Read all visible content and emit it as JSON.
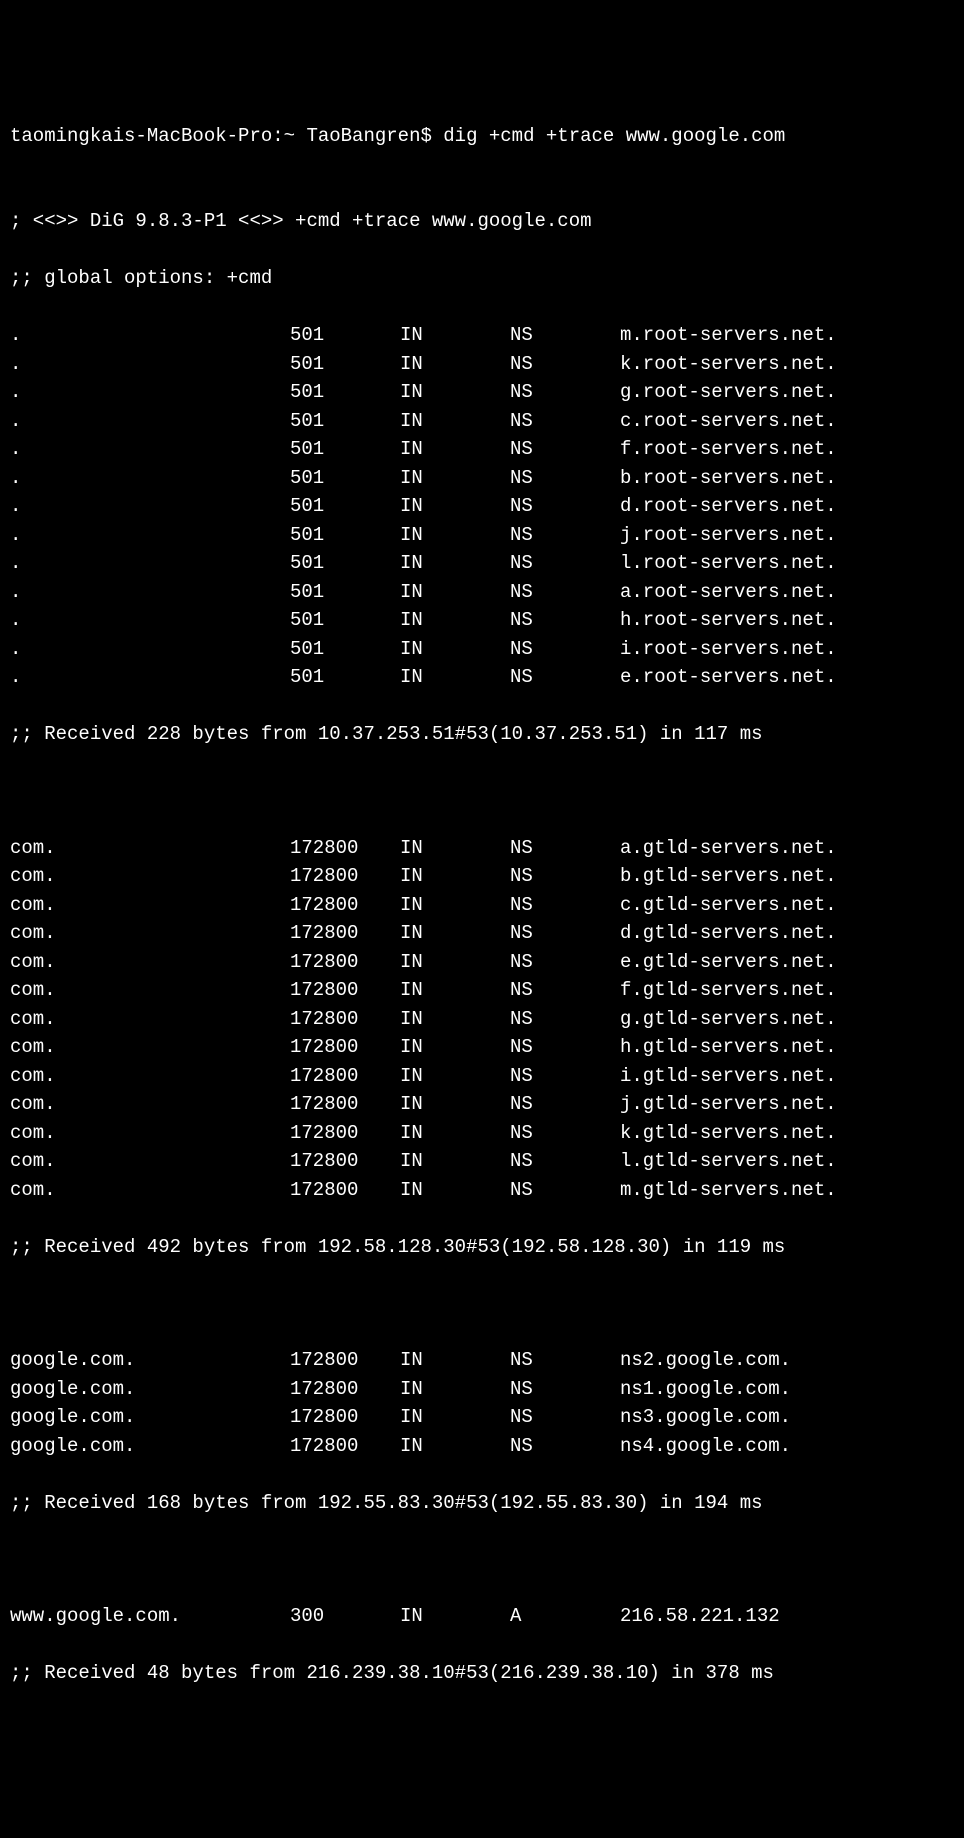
{
  "prompt": "taomingkais-MacBook-Pro:~ TaoBangren$ dig +cmd +trace www.google.com",
  "header1": "; <<>> DiG 9.8.3-P1 <<>> +cmd +trace www.google.com",
  "header2": ";; global options: +cmd",
  "root_records": [
    {
      "name": ".",
      "ttl": "501",
      "class": "IN",
      "type": "NS",
      "data": "m.root-servers.net."
    },
    {
      "name": ".",
      "ttl": "501",
      "class": "IN",
      "type": "NS",
      "data": "k.root-servers.net."
    },
    {
      "name": ".",
      "ttl": "501",
      "class": "IN",
      "type": "NS",
      "data": "g.root-servers.net."
    },
    {
      "name": ".",
      "ttl": "501",
      "class": "IN",
      "type": "NS",
      "data": "c.root-servers.net."
    },
    {
      "name": ".",
      "ttl": "501",
      "class": "IN",
      "type": "NS",
      "data": "f.root-servers.net."
    },
    {
      "name": ".",
      "ttl": "501",
      "class": "IN",
      "type": "NS",
      "data": "b.root-servers.net."
    },
    {
      "name": ".",
      "ttl": "501",
      "class": "IN",
      "type": "NS",
      "data": "d.root-servers.net."
    },
    {
      "name": ".",
      "ttl": "501",
      "class": "IN",
      "type": "NS",
      "data": "j.root-servers.net."
    },
    {
      "name": ".",
      "ttl": "501",
      "class": "IN",
      "type": "NS",
      "data": "l.root-servers.net."
    },
    {
      "name": ".",
      "ttl": "501",
      "class": "IN",
      "type": "NS",
      "data": "a.root-servers.net."
    },
    {
      "name": ".",
      "ttl": "501",
      "class": "IN",
      "type": "NS",
      "data": "h.root-servers.net."
    },
    {
      "name": ".",
      "ttl": "501",
      "class": "IN",
      "type": "NS",
      "data": "i.root-servers.net."
    },
    {
      "name": ".",
      "ttl": "501",
      "class": "IN",
      "type": "NS",
      "data": "e.root-servers.net."
    }
  ],
  "root_received": ";; Received 228 bytes from 10.37.253.51#53(10.37.253.51) in 117 ms",
  "com_records": [
    {
      "name": "com.",
      "ttl": "172800",
      "class": "IN",
      "type": "NS",
      "data": "a.gtld-servers.net."
    },
    {
      "name": "com.",
      "ttl": "172800",
      "class": "IN",
      "type": "NS",
      "data": "b.gtld-servers.net."
    },
    {
      "name": "com.",
      "ttl": "172800",
      "class": "IN",
      "type": "NS",
      "data": "c.gtld-servers.net."
    },
    {
      "name": "com.",
      "ttl": "172800",
      "class": "IN",
      "type": "NS",
      "data": "d.gtld-servers.net."
    },
    {
      "name": "com.",
      "ttl": "172800",
      "class": "IN",
      "type": "NS",
      "data": "e.gtld-servers.net."
    },
    {
      "name": "com.",
      "ttl": "172800",
      "class": "IN",
      "type": "NS",
      "data": "f.gtld-servers.net."
    },
    {
      "name": "com.",
      "ttl": "172800",
      "class": "IN",
      "type": "NS",
      "data": "g.gtld-servers.net."
    },
    {
      "name": "com.",
      "ttl": "172800",
      "class": "IN",
      "type": "NS",
      "data": "h.gtld-servers.net."
    },
    {
      "name": "com.",
      "ttl": "172800",
      "class": "IN",
      "type": "NS",
      "data": "i.gtld-servers.net."
    },
    {
      "name": "com.",
      "ttl": "172800",
      "class": "IN",
      "type": "NS",
      "data": "j.gtld-servers.net."
    },
    {
      "name": "com.",
      "ttl": "172800",
      "class": "IN",
      "type": "NS",
      "data": "k.gtld-servers.net."
    },
    {
      "name": "com.",
      "ttl": "172800",
      "class": "IN",
      "type": "NS",
      "data": "l.gtld-servers.net."
    },
    {
      "name": "com.",
      "ttl": "172800",
      "class": "IN",
      "type": "NS",
      "data": "m.gtld-servers.net."
    }
  ],
  "com_received": ";; Received 492 bytes from 192.58.128.30#53(192.58.128.30) in 119 ms",
  "google_records": [
    {
      "name": "google.com.",
      "ttl": "172800",
      "class": "IN",
      "type": "NS",
      "data": "ns2.google.com."
    },
    {
      "name": "google.com.",
      "ttl": "172800",
      "class": "IN",
      "type": "NS",
      "data": "ns1.google.com."
    },
    {
      "name": "google.com.",
      "ttl": "172800",
      "class": "IN",
      "type": "NS",
      "data": "ns3.google.com."
    },
    {
      "name": "google.com.",
      "ttl": "172800",
      "class": "IN",
      "type": "NS",
      "data": "ns4.google.com."
    }
  ],
  "google_received": ";; Received 168 bytes from 192.55.83.30#53(192.55.83.30) in 194 ms",
  "final_records": [
    {
      "name": "www.google.com.",
      "ttl": "300",
      "class": "IN",
      "type": "A",
      "data": "216.58.221.132"
    }
  ],
  "final_received": ";; Received 48 bytes from 216.239.38.10#53(216.239.38.10) in 378 ms"
}
